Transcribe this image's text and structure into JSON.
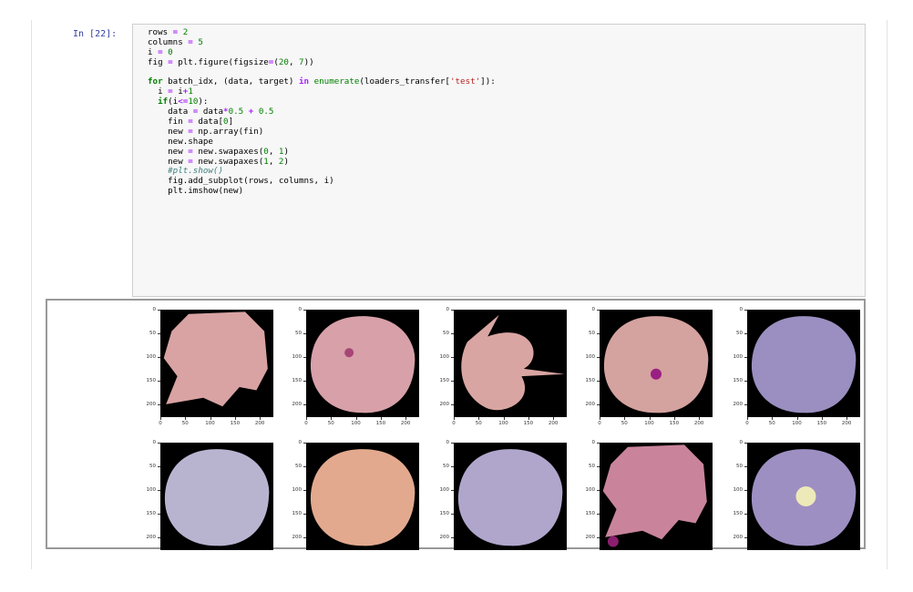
{
  "cell": {
    "prompt": "In [22]:",
    "code_lines": [
      "rows = 2",
      "columns = 5",
      "i = 0",
      "fig = plt.figure(figsize=(20, 7))",
      "",
      "for batch_idx, (data, target) in enumerate(loaders_transfer['test']):",
      "  i = i+1",
      "  if(i<=10):",
      "    data = data*0.5 + 0.5",
      "    fin = data[0]",
      "    new = np.array(fin)",
      "    new.shape",
      "    new = new.swapaxes(0, 1)",
      "    new = new.swapaxes(1, 2)",
      "    #plt.show()",
      "    fig.add_subplot(rows, columns, i)",
      "    plt.imshow(new)"
    ]
  },
  "output": {
    "ytick_labels_top": [
      "0",
      "50",
      "100",
      "150",
      "200"
    ],
    "ytick_labels_bottom": [
      "0",
      "50",
      "100",
      "150",
      "200"
    ],
    "xtick_labels": [
      "0",
      "50",
      "100",
      "150",
      "200"
    ],
    "subplots": [
      {
        "row": 0,
        "col": 0,
        "cell_icon": "cell-image-icon",
        "fill": "#d9a3a3",
        "shape": "irregular-blob",
        "dot": null,
        "dot_color": null
      },
      {
        "row": 0,
        "col": 1,
        "cell_icon": "cell-image-icon",
        "fill": "#d8a0a8",
        "shape": "round",
        "dot": "center-left",
        "dot_color": "#a84577"
      },
      {
        "row": 0,
        "col": 2,
        "cell_icon": "cell-image-icon",
        "fill": "#d9a5a2",
        "shape": "torn-circle",
        "dot": null,
        "dot_color": null
      },
      {
        "row": 0,
        "col": 3,
        "cell_icon": "cell-image-icon",
        "fill": "#d4a29f",
        "shape": "round",
        "dot": "center",
        "dot_color": "#9a1f82"
      },
      {
        "row": 0,
        "col": 4,
        "cell_icon": "cell-image-icon",
        "fill": "#9a8fc0",
        "shape": "round",
        "dot": null,
        "dot_color": null
      },
      {
        "row": 1,
        "col": 0,
        "cell_icon": "cell-image-icon",
        "fill": "#b8b4d0",
        "shape": "round",
        "dot": null,
        "dot_color": null
      },
      {
        "row": 1,
        "col": 1,
        "cell_icon": "cell-image-icon",
        "fill": "#e2a98e",
        "shape": "round",
        "dot": null,
        "dot_color": null
      },
      {
        "row": 1,
        "col": 2,
        "cell_icon": "cell-image-icon",
        "fill": "#b0a6cc",
        "shape": "round",
        "dot": null,
        "dot_color": null
      },
      {
        "row": 1,
        "col": 3,
        "cell_icon": "cell-image-icon",
        "fill": "#c9849c",
        "shape": "irregular-blob",
        "dot": "bottom-left",
        "dot_color": "#8a1f6e"
      },
      {
        "row": 1,
        "col": 4,
        "cell_icon": "cell-image-icon",
        "fill": "#9d8fc2",
        "shape": "round",
        "dot": "center-bright",
        "dot_color": "#ede9b8"
      }
    ]
  }
}
